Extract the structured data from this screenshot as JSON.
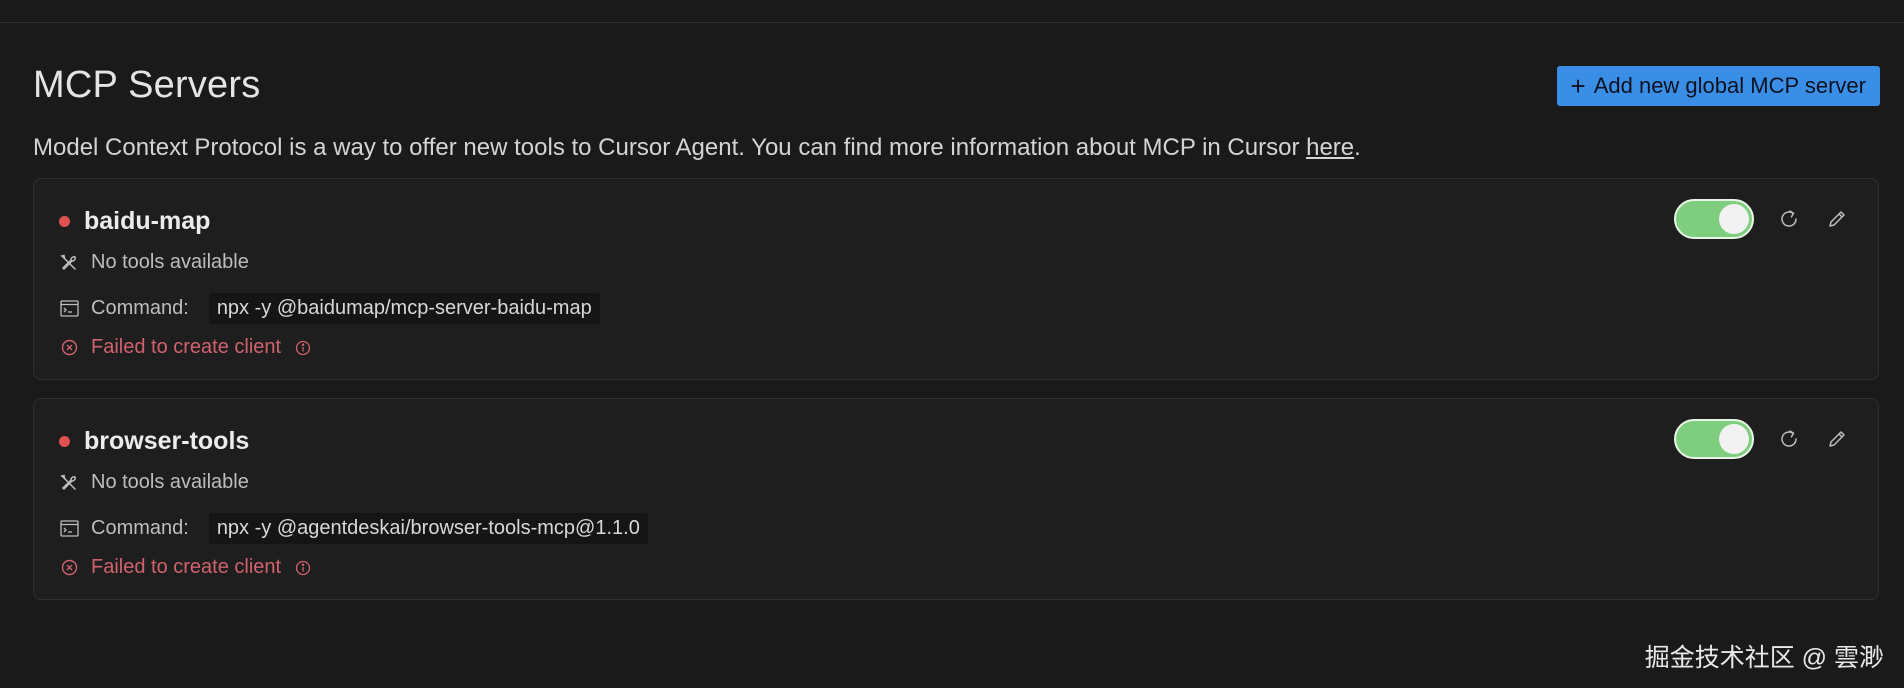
{
  "header": {
    "title": "MCP Servers",
    "add_button_label": "Add new global MCP server"
  },
  "description": {
    "text": "Model Context Protocol is a way to offer new tools to Cursor Agent. You can find more information about MCP in Cursor ",
    "link_text": "here",
    "suffix": "."
  },
  "servers": [
    {
      "name": "baidu-map",
      "status_color": "#e05252",
      "tools_text": "No tools available",
      "command_label": "Command:",
      "command": "npx -y @baidumap/mcp-server-baidu-map",
      "error_text": "Failed to create client",
      "enabled": true
    },
    {
      "name": "browser-tools",
      "status_color": "#e05252",
      "tools_text": "No tools available",
      "command_label": "Command:",
      "command": "npx -y @agentdeskai/browser-tools-mcp@1.1.0",
      "error_text": "Failed to create client",
      "enabled": true
    }
  ],
  "colors": {
    "accent": "#3a8ee6",
    "toggle_on": "#7fce7f",
    "error": "#d0626d"
  },
  "icons": {
    "add": "plus-icon",
    "tools": "wrench-screwdriver-icon",
    "command": "terminal-icon",
    "error": "circle-x-icon",
    "info": "info-icon",
    "refresh": "refresh-icon",
    "edit": "pencil-icon"
  },
  "watermark": "掘金技术社区 @ 雲渺"
}
